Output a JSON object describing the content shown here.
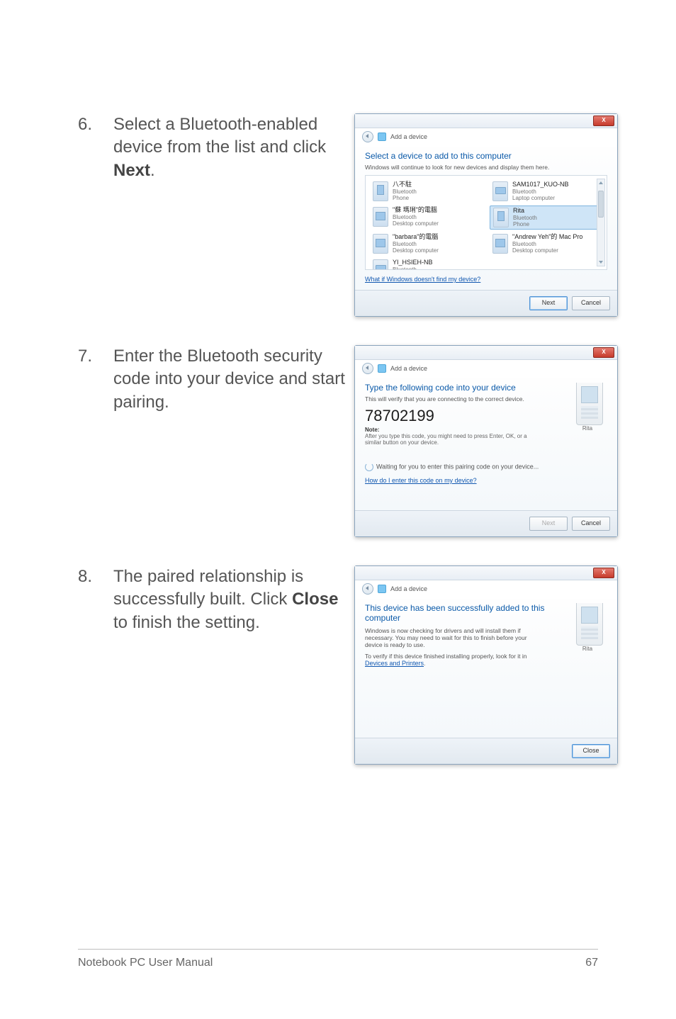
{
  "steps": {
    "s6": {
      "num": "6.",
      "text_a": "Select a Bluetooth-enabled device from the list and click ",
      "text_b": "Next",
      "text_c": "."
    },
    "s7": {
      "num": "7.",
      "text": "Enter the Bluetooth security code into your device and start pairing."
    },
    "s8": {
      "num": "8.",
      "text_a": "The paired relationship is successfully built. Click ",
      "text_b": "Close",
      "text_c": " to finish the setting."
    }
  },
  "dialog_common": {
    "breadcrumb": "Add a device",
    "close_x": "X"
  },
  "dlg1": {
    "title": "Select a device to add to this computer",
    "subtitle": "Windows will continue to look for new devices and display them here.",
    "devices": [
      {
        "name": "八不駐",
        "t1": "Bluetooth",
        "t2": "Phone",
        "type": "phone"
      },
      {
        "name": "SAM1017_KUO-NB",
        "t1": "Bluetooth",
        "t2": "Laptop computer",
        "type": "laptop"
      },
      {
        "name": "\"蘇 瑪琍\"的電腦",
        "t1": "Bluetooth",
        "t2": "Desktop computer",
        "type": "desktop"
      },
      {
        "name": "Rita",
        "t1": "Bluetooth",
        "t2": "Phone",
        "type": "phone",
        "selected": true
      },
      {
        "name": "\"barbara\"的電腦",
        "t1": "Bluetooth",
        "t2": "Desktop computer",
        "type": "desktop"
      },
      {
        "name": "\"Andrew Yeh\"的 Mac Pro",
        "t1": "Bluetooth",
        "t2": "Desktop computer",
        "type": "desktop"
      },
      {
        "name": "YI_HSIEH-NB",
        "t1": "Bluetooth",
        "t2": "",
        "type": "laptop"
      }
    ],
    "help_link": "What if Windows doesn't find my device?",
    "btn_next": "Next",
    "btn_cancel": "Cancel"
  },
  "dlg2": {
    "title": "Type the following code into your device",
    "subtitle": "This will verify that you are connecting to the correct device.",
    "code": "78702199",
    "note_label": "Note:",
    "note_body": "After you type this code, you might need to press Enter, OK, or a similar button on your device.",
    "waiting": "Waiting for you to enter this pairing code on your device...",
    "help_link": "How do I enter this code on my device?",
    "device_label": "Rita",
    "btn_next": "Next",
    "btn_cancel": "Cancel"
  },
  "dlg3": {
    "title": "This device has been successfully added to this computer",
    "body1": "Windows is now checking for drivers and will install them if necessary. You may need to wait for this to finish before your device is ready to use.",
    "body2_a": "To verify if this device finished installing properly, look for it in ",
    "body2_link": "Devices and Printers",
    "body2_b": ".",
    "device_label": "Rita",
    "btn_close": "Close"
  },
  "footer": {
    "left": "Notebook PC User Manual",
    "right": "67"
  }
}
